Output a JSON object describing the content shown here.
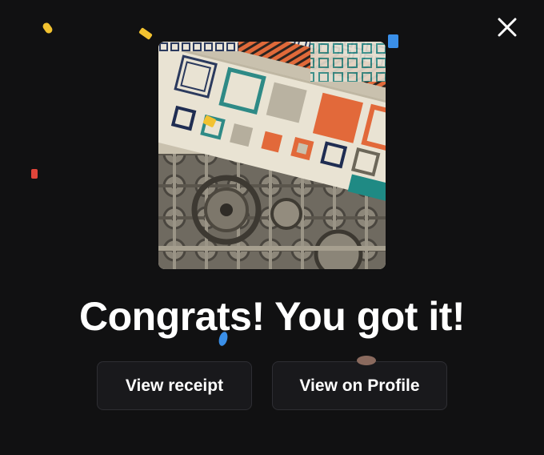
{
  "dialog": {
    "headline": "Congrats! You got it!",
    "close_icon": "close-icon",
    "artwork_icon": "nft-artwork-image"
  },
  "actions": {
    "view_receipt_label": "View receipt",
    "view_on_profile_label": "View on Profile"
  },
  "colors": {
    "background": "#111112",
    "button_background": "#19191c",
    "button_border": "#2e2e33",
    "text": "#ffffff",
    "confetti_yellow": "#f2c230",
    "confetti_blue": "#3a8fe8",
    "confetti_red": "#e0453a",
    "confetti_brown": "#8a6a5e"
  }
}
